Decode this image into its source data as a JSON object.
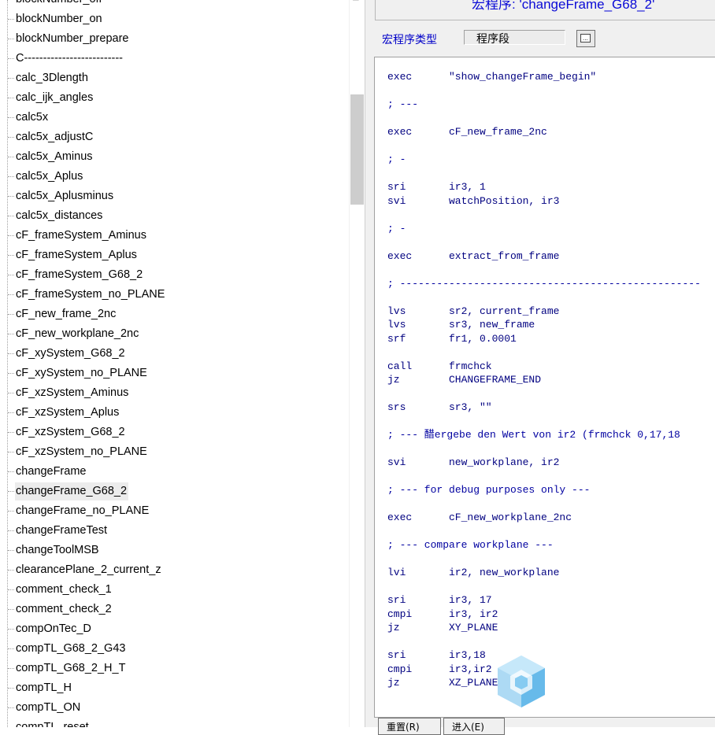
{
  "tree": {
    "items": [
      "blockNumber_off",
      "blockNumber_on",
      "blockNumber_prepare",
      "C--------------------------",
      "calc_3Dlength",
      "calc_ijk_angles",
      "calc5x",
      "calc5x_adjustC",
      "calc5x_Aminus",
      "calc5x_Aplus",
      "calc5x_Aplusminus",
      "calc5x_distances",
      "cF_frameSystem_Aminus",
      "cF_frameSystem_Aplus",
      "cF_frameSystem_G68_2",
      "cF_frameSystem_no_PLANE",
      "cF_new_frame_2nc",
      "cF_new_workplane_2nc",
      "cF_xySystem_G68_2",
      "cF_xySystem_no_PLANE",
      "cF_xzSystem_Aminus",
      "cF_xzSystem_Aplus",
      "cF_xzSystem_G68_2",
      "cF_xzSystem_no_PLANE",
      "changeFrame",
      "changeFrame_G68_2",
      "changeFrame_no_PLANE",
      "changeFrameTest",
      "changeToolMSB",
      "clearancePlane_2_current_z",
      "comment_check_1",
      "comment_check_2",
      "compOnTec_D",
      "compTL_G68_2_G43",
      "compTL_G68_2_H_T",
      "compTL_H",
      "compTL_ON",
      "compTL_reset"
    ],
    "selected": "changeFrame_G68_2"
  },
  "panel": {
    "title": "宏程序: 'changeFrame_G68_2'",
    "type_label": "宏程序类型",
    "type_value": "程序段",
    "buttons": [
      "重置(R)",
      "进入(E)"
    ]
  },
  "code": [
    [
      "exec",
      "\"show_changeFrame_begin\""
    ],
    [
      "",
      ""
    ],
    [
      "; ---",
      ""
    ],
    [
      "",
      ""
    ],
    [
      "exec",
      "cF_new_frame_2nc"
    ],
    [
      "",
      ""
    ],
    [
      "; -",
      ""
    ],
    [
      "",
      ""
    ],
    [
      "sri",
      "ir3, 1"
    ],
    [
      "svi",
      "watchPosition, ir3"
    ],
    [
      "",
      ""
    ],
    [
      "; -",
      ""
    ],
    [
      "",
      ""
    ],
    [
      "exec",
      "extract_from_frame"
    ],
    [
      "",
      ""
    ],
    [
      "; -------------------------------------------------",
      ""
    ],
    [
      "",
      ""
    ],
    [
      "lvs",
      "sr2, current_frame"
    ],
    [
      "lvs",
      "sr3, new_frame"
    ],
    [
      "srf",
      "fr1, 0.0001"
    ],
    [
      "",
      ""
    ],
    [
      "call",
      "frmchck"
    ],
    [
      "jz",
      "CHANGEFRAME_END"
    ],
    [
      "",
      ""
    ],
    [
      "srs",
      "sr3, \"\""
    ],
    [
      "",
      ""
    ],
    [
      "; --- 醋ergebe den Wert von ir2 (frmchck 0,17,18",
      ""
    ],
    [
      "",
      ""
    ],
    [
      "svi",
      "new_workplane, ir2"
    ],
    [
      "",
      ""
    ],
    [
      "; --- for debug purposes only ---",
      ""
    ],
    [
      "",
      ""
    ],
    [
      "exec",
      "cF_new_workplane_2nc"
    ],
    [
      "",
      ""
    ],
    [
      "; --- compare workplane ---",
      ""
    ],
    [
      "",
      ""
    ],
    [
      "lvi",
      "ir2, new_workplane"
    ],
    [
      "",
      ""
    ],
    [
      "sri",
      "ir3, 17"
    ],
    [
      "cmpi",
      "ir3, ir2"
    ],
    [
      "jz",
      "XY_PLANE"
    ],
    [
      "",
      ""
    ],
    [
      "sri",
      "ir3,18"
    ],
    [
      "cmpi",
      "ir3,ir2"
    ],
    [
      "jz",
      "XZ_PLANE"
    ]
  ],
  "colors": {
    "title_text": "#0b0bd6",
    "code_text": "#000080",
    "selection": "#ececec"
  },
  "icons": {
    "type_button": "ellipsis-browse-icon",
    "watermark": "cube-watermark-icon"
  }
}
